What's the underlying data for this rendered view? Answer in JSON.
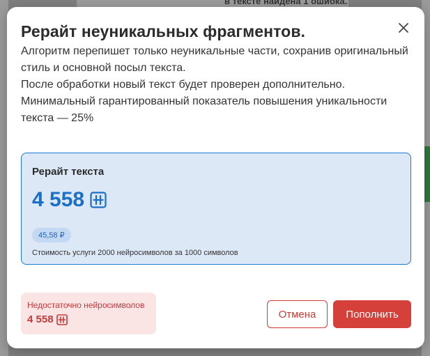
{
  "background": {
    "top_text": "в тексте найдена 1 ошибка."
  },
  "modal": {
    "title": "Рерайт неуникальных фрагментов.",
    "description": [
      "Алгоритм перепишет только неуникальные части, сохранив оригинальный стиль и основной посыл текста.",
      "После обработки новый текст будет проверен дополнительно.",
      "Минимальный гарантированный показатель повышения уникальности текста — 25%"
    ],
    "close_icon": "close-icon"
  },
  "card": {
    "title": "Рерайт текста",
    "amount": "4 558",
    "price": "45,58 ₽",
    "note": "Стоимость услуги 2000 нейросимволов за 1000 символов",
    "currency_icon": "neuro-symbol-icon"
  },
  "insufficient": {
    "label": "Недостаточно нейросимволов",
    "amount": "4 558"
  },
  "buttons": {
    "cancel_label": "Отмена",
    "topup_label": "Пополнить"
  },
  "colors": {
    "accent_blue": "#1a6fc7",
    "card_bg": "#dde8f7",
    "danger_red": "#d6403a",
    "danger_bg": "#fbe4e4"
  }
}
